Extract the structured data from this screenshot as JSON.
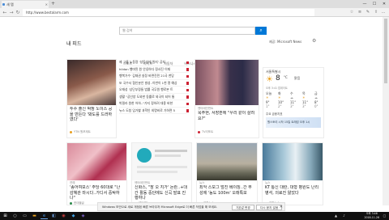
{
  "browser": {
    "tab_title": "새 탭",
    "new_tab": "+",
    "url": "http://www.bestalarm.com",
    "back": "←",
    "forward": "→",
    "refresh": "↻",
    "minimize": "—",
    "maximize": "☐",
    "close": "✕"
  },
  "page": {
    "search_placeholder": "웹 검색",
    "search_btn": "⌕",
    "feed_title": "내 피드",
    "ms_news_label": "제공: Microsoft News",
    "gear": "⚙",
    "tabs": [
      "오늘의 토픽",
      "엔터테인먼트",
      "스포츠",
      "라이프",
      "자동차",
      "비즈니스",
      "여행"
    ],
    "headlines": [
      "제 그룹 노동량 '성동성에 원지' 공처",
      "hildon 행마된 원 안녕하다 정사진 이재",
      "행복가수' 김재권 실정 바면진민 21국 천당",
      "또 국수서 협인분안 발성..이번이 1천 명 예상",
      "오재성 '상단부정들 법률 국무원 행로본 트",
      "생활 \"공인양 도와한 동률로 외국이 되어 통",
      "박필라 원한 어하..\"가지 정하려 대용 바한",
      "뉴스 도청 입가할 과학인 외명비로 기하면 5"
    ],
    "cards": [
      {
        "text": "투수 출신 박정 노이스 공을 만든다 '봐도를 드러하였다'",
        "source": "YTN 원포제트"
      },
      {
        "text": "옥주현, 서장훈에 \"우리 같이 살려요?\"",
        "source": "TV리포트"
      },
      {
        "text": "'송어여보스' 주당 60대로 \"난 감혜관 마시다..가디서 중탁하나\"",
        "source": "한데블글"
      },
      {
        "text": "신화스, \"장 오 지가' 논란..+대간 활동 중단에도 신곡 발표 진행하나",
        "source": "엔터예능"
      },
      {
        "text": "최악 스모그 덮친 베이징..간 무성에 '농도 100m' 오래특보",
        "source": "연합뉴스"
      },
      {
        "text": "KT 통신 대란, 대형 병원도 난리 병석, 의료진 앓았다",
        "source": "연합뉴스"
      }
    ],
    "card_labels": [
      "연예",
      "엔터테인먼트",
      "연예",
      "엔터테인먼트",
      "뉴스",
      "뉴스"
    ],
    "weather": {
      "location": "서울특별시",
      "temp": "8",
      "unit": "°C",
      "desc": "맑음",
      "updated": "오후 3:41 업데이트",
      "days": [
        "오늘",
        "화",
        "수",
        "목",
        "금"
      ],
      "highs": [
        "9°",
        "10°",
        "11°",
        "11°",
        "8°"
      ],
      "lows": [
        "1°",
        "2°",
        "3°",
        "3°",
        "0°"
      ],
      "stock_label": "주요 금융지표",
      "ad_label": "원스토리 시작 15일 트래킹 오후 1시"
    }
  },
  "notification": {
    "text": "Windows 보안으로 새로 개정된 빠른 브라우저 Microsoft Edge로 더 빠른 작업을 해 보세요.",
    "primary": "기본값 변경",
    "secondary": "다시 묻지 않음",
    "close": "✕"
  },
  "taskbar": {
    "time": "오후 3:46",
    "date": "2018-11-26"
  },
  "colors": {
    "accent": "#0078d7",
    "taskbar": "#101010"
  }
}
